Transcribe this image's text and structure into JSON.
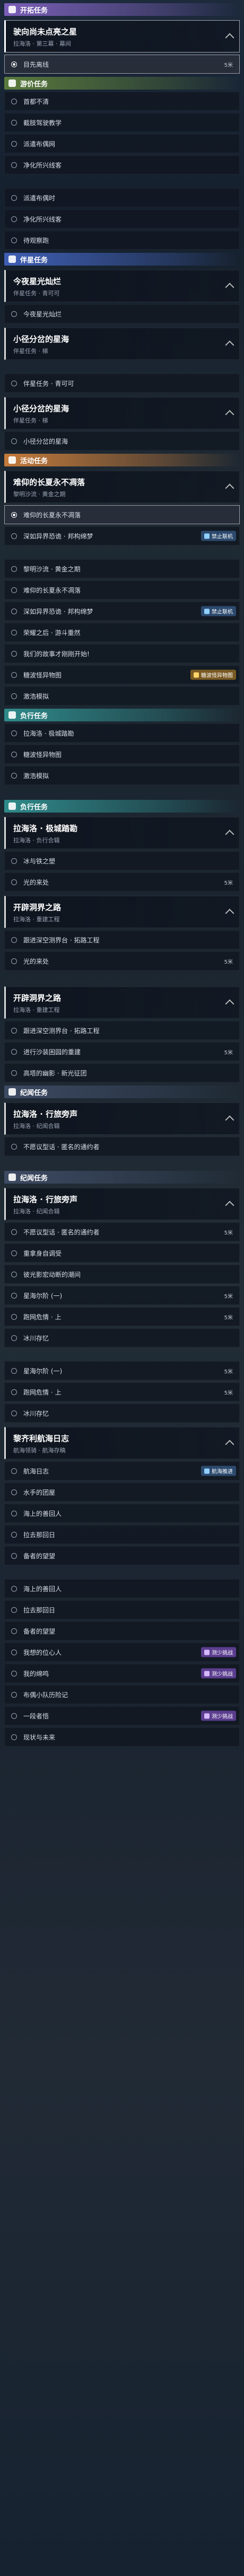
{
  "colors": {
    "story": "#7b5fb8",
    "daily": "#5a7a3c",
    "companion": "#3f5fb5",
    "event": "#c47a3a",
    "adventure": "#2f8a8a",
    "dossier": "#3d4a63"
  },
  "cat_icon": "category-icon",
  "sections": [
    {
      "type": "cat",
      "style": "story",
      "label": "开拓任务"
    },
    {
      "type": "quest",
      "title": "驶向尚未点亮之星",
      "sub": "拉海洛 · 第三幕 · 幕间",
      "selected": true
    },
    {
      "type": "step",
      "label": "目先离线",
      "dist": "5米",
      "active": true
    },
    {
      "type": "cat",
      "style": "daily",
      "label": "游价任务"
    },
    {
      "type": "step",
      "label": "首都不清"
    },
    {
      "type": "step",
      "label": "截肢驾驶教学"
    },
    {
      "type": "step",
      "label": "派遣布偶网"
    },
    {
      "type": "step",
      "label": "净化所兴线客"
    },
    {
      "type": "gap"
    },
    {
      "type": "step",
      "label": "派遣布偶时"
    },
    {
      "type": "step",
      "label": "净化所兴线客"
    },
    {
      "type": "step",
      "label": "待观察跑"
    },
    {
      "type": "cat",
      "style": "companion",
      "label": "伴星任务"
    },
    {
      "type": "quest",
      "title": "今夜星光灿烂",
      "sub": "伴星任务 · 青可可"
    },
    {
      "type": "step",
      "label": "今夜星光灿烂"
    },
    {
      "type": "quest",
      "title": "小径分岔的星海",
      "sub": "伴星任务 · 梯"
    },
    {
      "type": "gap"
    },
    {
      "type": "step",
      "label": "伴星任务 · 青可可"
    },
    {
      "type": "quest",
      "title": "小径分岔的星海",
      "sub": "伴星任务 · 梯"
    },
    {
      "type": "step",
      "label": "小径分岔的星海"
    },
    {
      "type": "cat",
      "style": "event",
      "label": "活动任务"
    },
    {
      "type": "quest",
      "title": "难仰的长夏永不凋落",
      "sub": "黎明沙流 · 黄金之期"
    },
    {
      "type": "step",
      "label": "难仰的长夏永不凋落",
      "active": true
    },
    {
      "type": "step",
      "label": "深如异界恐诡 · 邦构绵梦",
      "badge": "禁止联机",
      "badgeStyle": "blue"
    },
    {
      "type": "gap"
    },
    {
      "type": "step",
      "label": "黎明沙流 · 黄金之期"
    },
    {
      "type": "step",
      "label": "难仰的长夏永不凋落"
    },
    {
      "type": "step",
      "label": "深如异界恐诡 · 邦构绵梦",
      "badge": "禁止联机",
      "badgeStyle": "blue"
    },
    {
      "type": "step",
      "label": "荣耀之后 · 游斗重然"
    },
    {
      "type": "step",
      "label": "我们的故事才刚刚开始!"
    },
    {
      "type": "step",
      "label": "糖波怪异物图",
      "badge": "糖波怪异物图",
      "badgeStyle": "gold"
    },
    {
      "type": "step",
      "label": "激浩模拟"
    },
    {
      "type": "cat",
      "style": "adv",
      "label": "负行任务"
    },
    {
      "type": "step",
      "label": "拉海洛 · 极城踏勘"
    },
    {
      "type": "step",
      "label": "糖波怪异物图"
    },
    {
      "type": "step",
      "label": "激浩模拟"
    },
    {
      "type": "gap"
    },
    {
      "type": "cat",
      "style": "adv",
      "label": "负行任务"
    },
    {
      "type": "quest",
      "title": "拉海洛 · 极城踏勘",
      "sub": "拉海洛 · 负行合辑"
    },
    {
      "type": "step",
      "label": "冰与铁之塑"
    },
    {
      "type": "step",
      "label": "光的来处",
      "dist": "5米"
    },
    {
      "type": "quest",
      "title": "开辟洞界之路",
      "sub": "拉海洛 · 重建工程"
    },
    {
      "type": "step",
      "label": "跟进深空测界台 · 拓路工程"
    },
    {
      "type": "step",
      "label": "光的来处",
      "dist": "5米"
    },
    {
      "type": "gap"
    },
    {
      "type": "quest",
      "title": "开辟洞界之路",
      "sub": "拉海洛 · 重建工程"
    },
    {
      "type": "step",
      "label": "跟进深空测界台 · 拓路工程"
    },
    {
      "type": "step",
      "label": "进行沙装困园的重建",
      "dist": "5米"
    },
    {
      "type": "step",
      "label": "高塔的幽影 · 新光征团"
    },
    {
      "type": "cat",
      "style": "dossier",
      "label": "纪闻任务"
    },
    {
      "type": "quest",
      "title": "拉海洛 · 行旅旁声",
      "sub": "拉海洛 · 纪闻合辑"
    },
    {
      "type": "step",
      "label": "不愿议型话 · 匿名的通约者"
    },
    {
      "type": "gap"
    },
    {
      "type": "cat",
      "style": "dossier",
      "label": "纪闻任务"
    },
    {
      "type": "quest",
      "title": "拉海洛 · 行旅旁声",
      "sub": "拉海洛 · 纪闻合辑"
    },
    {
      "type": "step",
      "label": "不愿议型话 · 匿名的通约者",
      "dist": "5米"
    },
    {
      "type": "step",
      "label": "重拿身自调受"
    },
    {
      "type": "step",
      "label": "彼光影宏动断的潮间"
    },
    {
      "type": "step",
      "label": "星海尔阶 (一)",
      "dist": "5米"
    },
    {
      "type": "step",
      "label": "跑网危情 · 上",
      "dist": "5米"
    },
    {
      "type": "step",
      "label": "冰川存忆"
    },
    {
      "type": "gap"
    },
    {
      "type": "step",
      "label": "星海尔阶 (一)",
      "dist": "5米"
    },
    {
      "type": "step",
      "label": "跑网危情 · 上",
      "dist": "5米"
    },
    {
      "type": "step",
      "label": "冰川存忆"
    },
    {
      "type": "quest",
      "title": "黎齐利航海日志",
      "sub": "航海领骑 · 航海存稿"
    },
    {
      "type": "step",
      "label": "航海日志",
      "badge": "航海推进",
      "badgeStyle": "blue"
    },
    {
      "type": "step",
      "label": "水手的团屋"
    },
    {
      "type": "step",
      "label": "海上的善回人"
    },
    {
      "type": "step",
      "label": "拉去那回日"
    },
    {
      "type": "step",
      "label": "备者的望望"
    },
    {
      "type": "gap"
    },
    {
      "type": "step",
      "label": "海上的善回人"
    },
    {
      "type": "step",
      "label": "拉去那回日"
    },
    {
      "type": "step",
      "label": "备者的望望"
    },
    {
      "type": "step",
      "label": "我想的位心人",
      "badge": "测少挑战",
      "badgeStyle": "purple"
    },
    {
      "type": "step",
      "label": "我的绵鸣",
      "badge": "测少挑战",
      "badgeStyle": "purple"
    },
    {
      "type": "step",
      "label": "布偶小队历险记"
    },
    {
      "type": "step",
      "label": "一段者悟",
      "badge": "测少挑战",
      "badgeStyle": "purple"
    },
    {
      "type": "step",
      "label": "现状与未来"
    }
  ]
}
